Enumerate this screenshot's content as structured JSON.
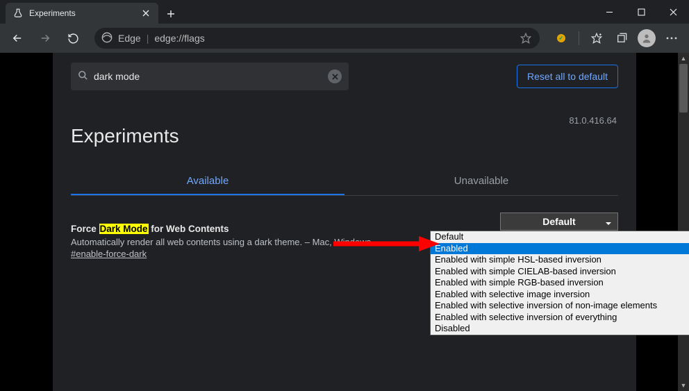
{
  "tab": {
    "title": "Experiments"
  },
  "address": {
    "brand": "Edge",
    "url": "edge://flags"
  },
  "search": {
    "value": "dark mode"
  },
  "reset_label": "Reset all to default",
  "page_title": "Experiments",
  "version": "81.0.416.64",
  "tabs": {
    "available": "Available",
    "unavailable": "Unavailable"
  },
  "flag": {
    "title_pre": "Force ",
    "title_hl": "Dark Mode",
    "title_post": " for Web Contents",
    "desc": "Automatically render all web contents using a dark theme. – Mac, Windows",
    "hash": "#enable-force-dark",
    "selected": "Default"
  },
  "dropdown": [
    "Default",
    "Enabled",
    "Enabled with simple HSL-based inversion",
    "Enabled with simple CIELAB-based inversion",
    "Enabled with simple RGB-based inversion",
    "Enabled with selective image inversion",
    "Enabled with selective inversion of non-image elements",
    "Enabled with selective inversion of everything",
    "Disabled"
  ],
  "dropdown_highlight_index": 1
}
